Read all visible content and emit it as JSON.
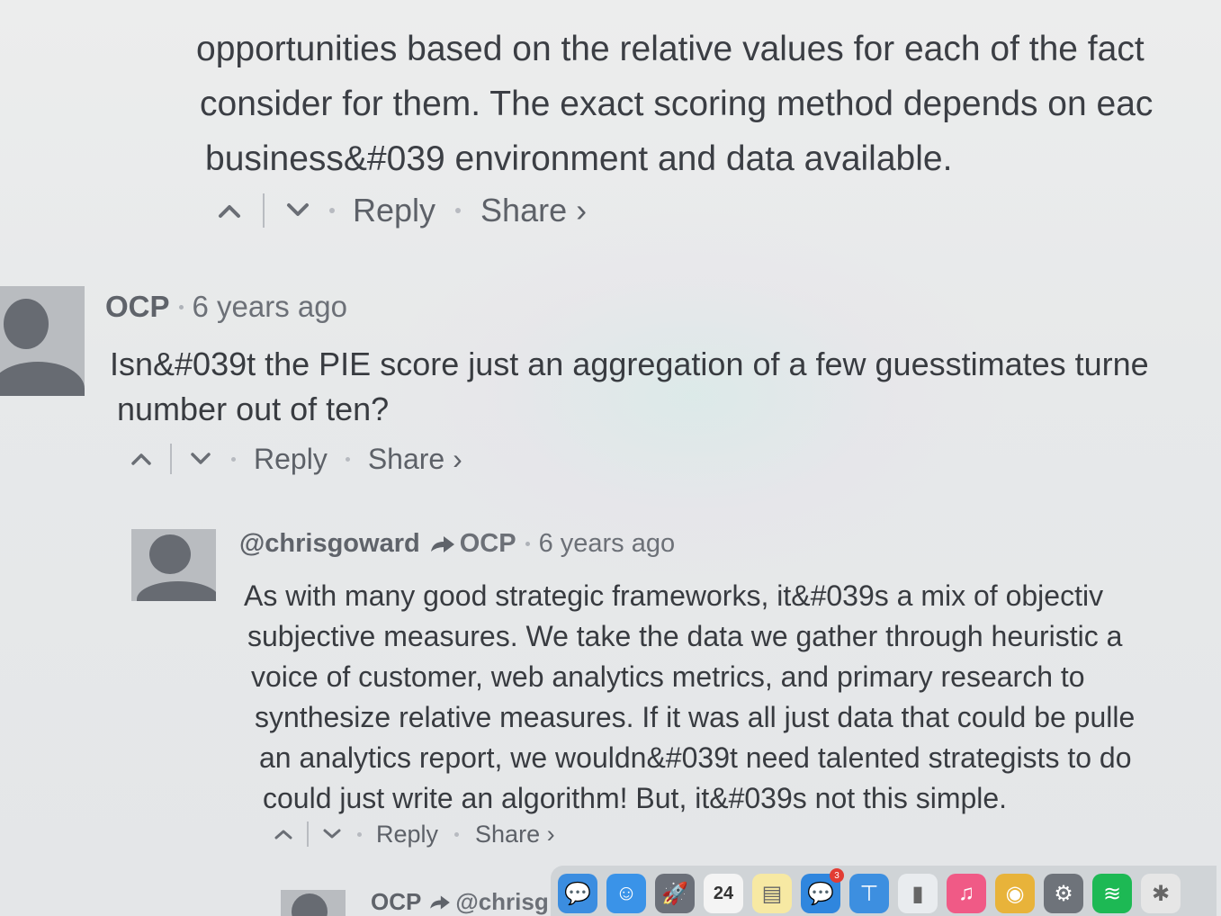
{
  "previous_comment": {
    "lines": [
      "opportunities based on the relative values for each of the fact",
      "consider for them. The exact scoring method depends on eac",
      "business&#039 environment and data available."
    ],
    "reply_label": "Reply",
    "share_label": "Share ›"
  },
  "comment_ocp": {
    "author": "OCP",
    "time": "6 years ago",
    "lines": [
      "Isn&#039t the PIE score just an aggregation of a few guesstimates turne",
      "number out of ten?"
    ],
    "reply_label": "Reply",
    "share_label": "Share ›"
  },
  "comment_chris": {
    "author": "@chrisgoward",
    "reply_to": "OCP",
    "time": "6 years ago",
    "lines": [
      "As with many good strategic frameworks, it&#039s a mix of objectiv",
      "subjective measures. We take the data we gather through heuristic a",
      "voice of customer, web analytics metrics, and primary research to",
      "synthesize relative measures. If it was all just data that could be pulle",
      "an analytics report, we wouldn&#039t need talented strategists to do",
      "could just write an algorithm! But, it&#039s not this simple."
    ],
    "reply_label": "Reply",
    "share_label": "Share ›"
  },
  "comment_next": {
    "author": "OCP",
    "reply_to": "@chrisg"
  },
  "dock": {
    "items": [
      {
        "name": "messages-app-icon",
        "color": "#3b8de0",
        "glyph": "💬",
        "badge": ""
      },
      {
        "name": "finder-app-icon",
        "color": "#3a93e8",
        "glyph": "☺",
        "badge": ""
      },
      {
        "name": "launchpad-app-icon",
        "color": "#6b7079",
        "glyph": "🚀",
        "badge": ""
      },
      {
        "name": "calendar-app-icon",
        "color": "#f4f4f4",
        "glyph": "24",
        "badge": ""
      },
      {
        "name": "notes-app-icon",
        "color": "#f7e9a3",
        "glyph": "▤",
        "badge": ""
      },
      {
        "name": "chat-app-icon",
        "color": "#2f86de",
        "glyph": "💬",
        "badge": "3"
      },
      {
        "name": "keynote-app-icon",
        "color": "#3d8fe0",
        "glyph": "⊤",
        "badge": ""
      },
      {
        "name": "numbers-app-icon",
        "color": "#e9ecef",
        "glyph": "▮",
        "badge": ""
      },
      {
        "name": "music-app-icon",
        "color": "#f05a86",
        "glyph": "♫",
        "badge": ""
      },
      {
        "name": "chrome-app-icon",
        "color": "#e8b33a",
        "glyph": "◉",
        "badge": ""
      },
      {
        "name": "system-preferences-app-icon",
        "color": "#6e737a",
        "glyph": "⚙",
        "badge": ""
      },
      {
        "name": "spotify-app-icon",
        "color": "#1db954",
        "glyph": "≋",
        "badge": ""
      },
      {
        "name": "slack-app-icon",
        "color": "#e6e6e6",
        "glyph": "✱",
        "badge": ""
      }
    ]
  }
}
